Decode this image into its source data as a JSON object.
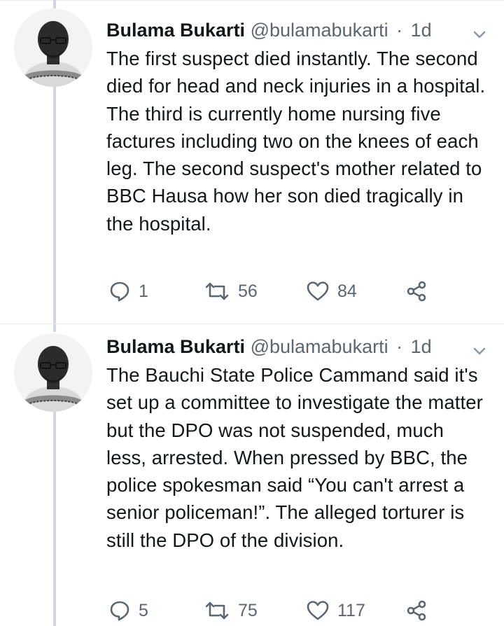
{
  "tweets": [
    {
      "author": "Bulama Bukarti",
      "handle": "@bulamabukarti",
      "separator": "·",
      "time": "1d",
      "text": "The first suspect died instantly. The second died for head and neck injuries in a hospital. The third is currently home nursing five factures including two on the knees of each leg. The second suspect's mother related to BBC Hausa how her son died tragically in the hospital.",
      "replies": "1",
      "retweets": "56",
      "likes": "84"
    },
    {
      "author": "Bulama Bukarti",
      "handle": "@bulamabukarti",
      "separator": "·",
      "time": "1d",
      "text": "The Bauchi State Police Cammand said it's set up a committee to investigate the matter but the DPO was not suspended, much less, arrested. When pressed by BBC, the police spokesman said “You can't arrest a senior policeman!”. The alleged torturer is still the DPO of the division.",
      "replies": "5",
      "retweets": "75",
      "likes": "117"
    }
  ],
  "icons": {
    "reply": "reply-icon",
    "retweet": "retweet-icon",
    "like": "heart-icon",
    "share": "share-icon",
    "more": "chevron-down-icon"
  },
  "colors": {
    "text": "#14171a",
    "secondary": "#5b6670",
    "thread_line": "#cfd6dc"
  }
}
